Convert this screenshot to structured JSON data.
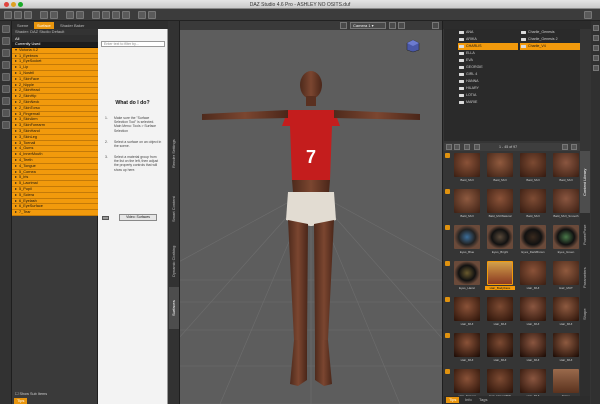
{
  "window": {
    "title": "DAZ Studio 4.6 Pro - ASHLEY NO OSITS.duf"
  },
  "scene_panel": {
    "tabs": [
      "Scene",
      "Surface",
      "Shader Baker"
    ],
    "active_tab": "Surface",
    "subheader": "Shader: DAZ Studio Default",
    "filters": [
      "All",
      "Currently Used"
    ],
    "items": [
      "Victoria 4.2",
      "1_Eyebrow",
      "1_EyeSocket",
      "1_Lip",
      "1_Nostril",
      "1_SkinFace",
      "2_Nipple",
      "2_SkinHead",
      "2_SkinHip",
      "2_SkinNeck",
      "2_SkinTorso",
      "3_Fingernail",
      "3_SkinArm",
      "3_SkinForearm",
      "3_SkinHand",
      "3_SkinLeg",
      "3_Toenail",
      "4_Gums",
      "4_InnerMouth",
      "4_Teeth",
      "4_Tongue",
      "5_Cornea",
      "5_Iris",
      "5_Lacrimal",
      "5_Pupil",
      "5_Sclera",
      "6_Eyelash",
      "6_EyeSurface",
      "7_Tear"
    ],
    "footer": "Show Sub Items",
    "bottom_tab": "Tips"
  },
  "tool_panel": {
    "search_placeholder": "Enter text to filter by...",
    "title": "What do I do?",
    "steps": [
      {
        "num": "1.",
        "text": "Make sure the \"Surface Selection Tool\" is selected. Main Menu: Tools > Surface Selection"
      },
      {
        "num": "2.",
        "text": "Select a surface on an object in the scene."
      },
      {
        "num": "3.",
        "text": "Select a material group from the list on the left, then adjust the property controls that will show up here."
      }
    ],
    "button": "Video: Surfaces"
  },
  "side_tabs": [
    "Render Settings",
    "Smart Content",
    "Dynamic Clothing",
    "Surfaces"
  ],
  "viewport": {
    "camera": "Camera 1",
    "jersey_number": "7"
  },
  "library": {
    "folders_left": [
      "ANA",
      "ARIKA",
      "CHARLIS",
      "ELLA",
      "EVA",
      "GEORGIE",
      "GIRL 4",
      "HANNA",
      "HILARY",
      "LOTIA",
      "MARIE"
    ],
    "folders_right": [
      "Charlie_Genesis",
      "Charlie_Genesis 2",
      "Charlie_V4"
    ],
    "selected_left": "CHARLIS",
    "selected_right": "Charlie_V4",
    "page_label": "1 - 45 of 97",
    "thumbs": [
      "Baid_MUI",
      "Baid_MUI",
      "Baid_MUI",
      "Baid_MUI",
      "Bald_MUI",
      "Bald_MUINatural",
      "Bald_MUI",
      "Bald_MUI_Smooth",
      "Eyes_Blue",
      "Eyes_Bright",
      "Eyes_DarkBrown",
      "Eyes_Green",
      "Eyes_Hazel",
      "Hair_BodyFace",
      "Hair_MUI",
      "Hair_MUT",
      "Hair_MUI",
      "Hair_MUI",
      "Hair_MUI",
      "Hair_MUI",
      "Hair_MUI",
      "Hair_MUI",
      "Hair_MUI",
      "Hair_MUI",
      "Hair_Natural",
      "Hair_NaturalBW",
      "Hair_MUI",
      "Tattoo"
    ],
    "selected_thumb": "Hair_BodyFace",
    "vtabs": [
      "Content Library",
      "PowerPose",
      "Parameters",
      "Shape"
    ],
    "bottom_tabs": [
      "Tips",
      "Info",
      "Tags"
    ]
  },
  "colors": {
    "accent": "#f29a0c",
    "panel_dark": "#353535",
    "viewport": "#5d5d5d"
  }
}
